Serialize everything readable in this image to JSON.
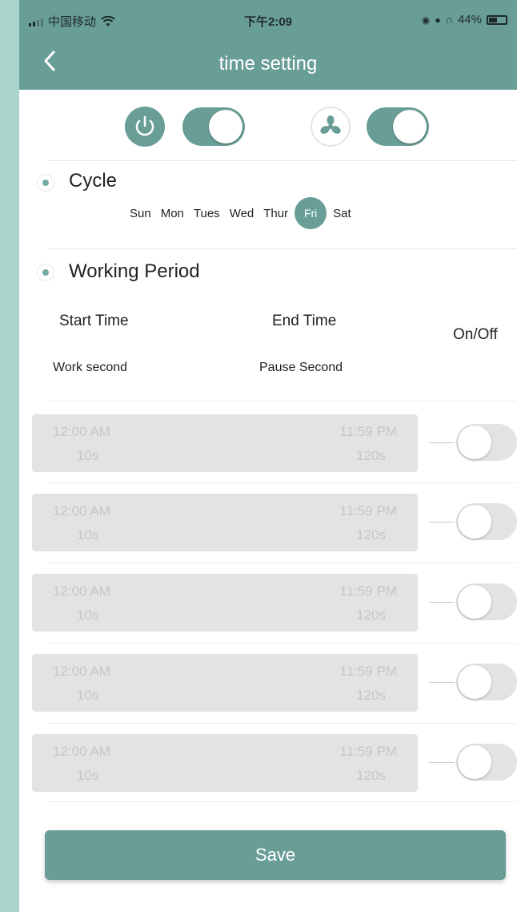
{
  "status_bar": {
    "carrier": "中国移动",
    "time": "下午2:09",
    "battery": "44%"
  },
  "nav": {
    "back_icon": "chevron-left-icon",
    "title": "time setting"
  },
  "device_controls": {
    "power_icon": "power-icon",
    "fan_icon": "fan-icon",
    "power_on": true,
    "fan_on": true
  },
  "cycle": {
    "title": "Cycle",
    "days": [
      "Sun",
      "Mon",
      "Tues",
      "Wed",
      "Thur",
      "Fri",
      "Sat"
    ],
    "selected": "Fri"
  },
  "working_period": {
    "title": "Working Period",
    "start_time_label": "Start Time",
    "end_time_label": "End Time",
    "on_off_label": "On/Off",
    "work_second_label": "Work second",
    "pause_second_label": "Pause Second",
    "rows": [
      {
        "start": "12:00 AM",
        "end": "11:59 PM",
        "work": "10s",
        "pause": "120s",
        "on": false
      },
      {
        "start": "12:00 AM",
        "end": "11:59 PM",
        "work": "10s",
        "pause": "120s",
        "on": false
      },
      {
        "start": "12:00 AM",
        "end": "11:59 PM",
        "work": "10s",
        "pause": "120s",
        "on": false
      },
      {
        "start": "12:00 AM",
        "end": "11:59 PM",
        "work": "10s",
        "pause": "120s",
        "on": false
      },
      {
        "start": "12:00 AM",
        "end": "11:59 PM",
        "work": "10s",
        "pause": "120s",
        "on": false
      }
    ]
  },
  "save_label": "Save",
  "colors": {
    "accent": "#699e97",
    "background": "#a9d5cc",
    "disabled": "#e3e3e3"
  }
}
